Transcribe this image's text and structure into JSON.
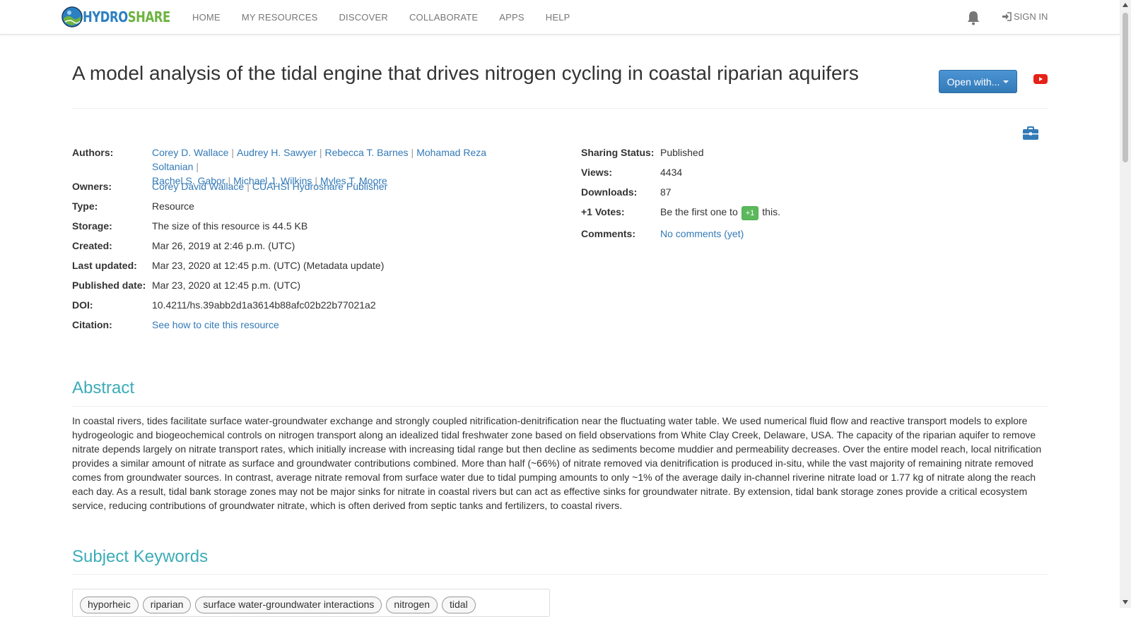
{
  "nav": {
    "logo_text_a": "HYDRO",
    "logo_text_b": "SHARE",
    "links": [
      "HOME",
      "MY RESOURCES",
      "DISCOVER",
      "COLLABORATE",
      "APPS",
      "HELP"
    ],
    "signin": "SIGN IN"
  },
  "resource": {
    "title": "A model analysis of the tidal engine that drives nitrogen cycling in coastal riparian aquifers",
    "open_with": "Open with..."
  },
  "meta": {
    "authors_label": "Authors:",
    "authors": [
      "Corey D. Wallace",
      "Audrey H. Sawyer",
      "Rebecca T. Barnes",
      "Mohamad Reza Soltanian",
      "Rachel S. Gabor",
      "Michael J. Wilkins",
      "Myles T. Moore"
    ],
    "owners_label": "Owners:",
    "owners": [
      "Corey David Wallace",
      "CUAHSI Hydroshare Publisher"
    ],
    "type_label": "Type:",
    "type": "Resource",
    "storage_label": "Storage:",
    "storage": "The size of this resource is 44.5 KB",
    "created_label": "Created:",
    "created": "Mar 26, 2019 at 2:46 p.m. (UTC)",
    "updated_label": "Last updated:",
    "updated": "Mar 23, 2020 at 12:45 p.m. (UTC) (Metadata update)",
    "published_label": "Published date:",
    "published": "Mar 23, 2020 at 12:45 p.m. (UTC)",
    "doi_label": "DOI:",
    "doi": "10.4211/hs.39abb2d1a3614b88afc02b22b77021a2",
    "citation_label": "Citation:",
    "citation": "See how to cite this resource",
    "sharing_label": "Sharing Status:",
    "sharing": "Published",
    "views_label": "Views:",
    "views": "4434",
    "downloads_label": "Downloads:",
    "downloads": "87",
    "votes_label": "+1 Votes:",
    "votes_before": "Be the first one to",
    "votes_button": "+1",
    "votes_after": "this.",
    "comments_label": "Comments:",
    "comments": "No comments (yet)"
  },
  "abstract": {
    "heading": "Abstract",
    "text": "In coastal rivers, tides facilitate surface water-groundwater exchange and strongly coupled nitrification-denitrification near the fluctuating water table. We used numerical fluid flow and reactive transport models to explore hydrogeologic and biogeochemical controls on nitrogen transport along an idealized tidal freshwater zone based on field observations from White Clay Creek, Delaware, USA. The capacity of the riparian aquifer to remove nitrate depends largely on nitrate transport rates, which initially increase with increasing tidal range but then decline as sediments become muddier and permeability decreases. Over the entire model reach, local nitrification provides a similar amount of nitrate as surface and groundwater contributions combined. More than half (~66%) of nitrate removed via denitrification is produced in-situ, while the vast majority of remaining nitrate removed comes from groundwater sources. In contrast, average nitrate removal from surface water due to tidal pumping amounts to only ~1% of the average daily in-channel riverine nitrate load or 1.77 kg of nitrate along the reach each day. As a result, tidal bank storage zones may not be major sinks for nitrate in coastal rivers but can act as effective sinks for groundwater nitrate. By extension, tidal bank storage zones provide a critical ecosystem service, reducing contributions of groundwater nitrate, which is often derived from septic tanks and fertilizers, to coastal rivers."
  },
  "keywords": {
    "heading": "Subject Keywords",
    "items": [
      "hyporheic",
      "riparian",
      "surface water-groundwater interactions",
      "nitrogen",
      "tidal"
    ]
  },
  "icons": {
    "bell": "bell-icon",
    "signin": "sign-in-icon",
    "youtube": "youtube-icon",
    "toolbox": "toolbox-icon"
  },
  "colors": {
    "link": "#337ab7",
    "section_heading": "#3bacb7",
    "primary_button": "#337ab7",
    "vote_button": "#5cb85c",
    "youtube": "#e62117"
  }
}
